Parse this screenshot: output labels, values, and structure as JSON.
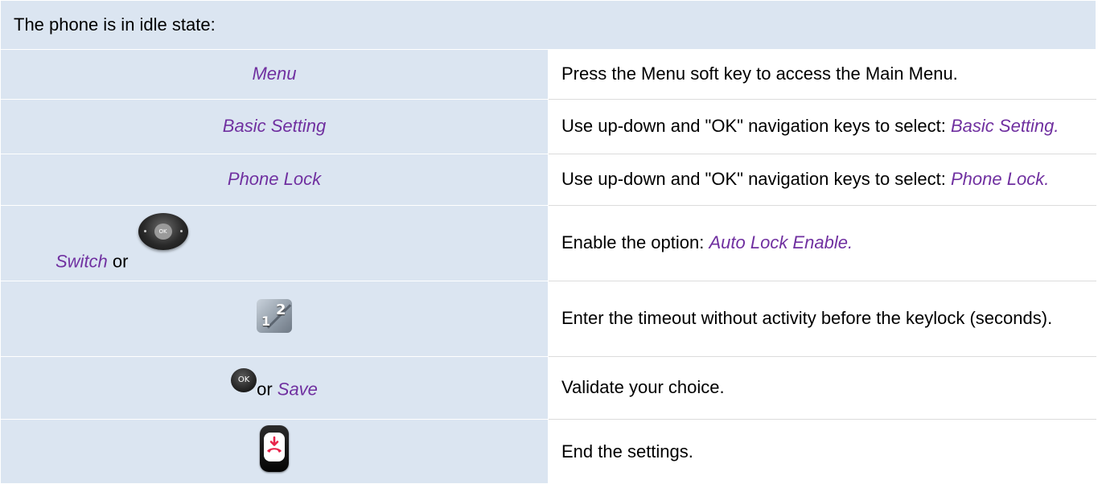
{
  "header": {
    "text": "The phone is in idle state:"
  },
  "rows": [
    {
      "key": "Menu",
      "desc": "Press the Menu soft key to access the Main Menu."
    },
    {
      "key": "Basic Setting",
      "desc_prefix": "Use up-down and \"OK\" navigation keys to select: ",
      "desc_em": "Basic Setting."
    },
    {
      "key": "Phone Lock",
      "desc_prefix": "Use up-down and \"OK\" navigation keys to select: ",
      "desc_em": "Phone Lock."
    },
    {
      "key": "Switch",
      "key_joiner": "or",
      "desc_prefix": "Enable the option: ",
      "desc_em": "Auto Lock Enable.",
      "icon": "navigation-wheel-icon"
    },
    {
      "desc": "Enter the timeout without activity before the keylock (seconds).",
      "icon": "keypad-icon"
    },
    {
      "key_joiner": "or",
      "key": "Save",
      "desc": "Validate your choice.",
      "icon": "ok-button-icon"
    },
    {
      "desc": "End the settings.",
      "icon": "end-call-key-icon"
    }
  ],
  "icons": {
    "nav_wheel_label": "OK",
    "ok_button_label": "OK",
    "keypad_digit_1": "1",
    "keypad_digit_2": "2"
  },
  "colors": {
    "accent_purple": "#7030a0",
    "header_bg": "#dbe5f1",
    "key_cell_bg": "#dbe5f1",
    "end_key_red": "#e8234a"
  }
}
